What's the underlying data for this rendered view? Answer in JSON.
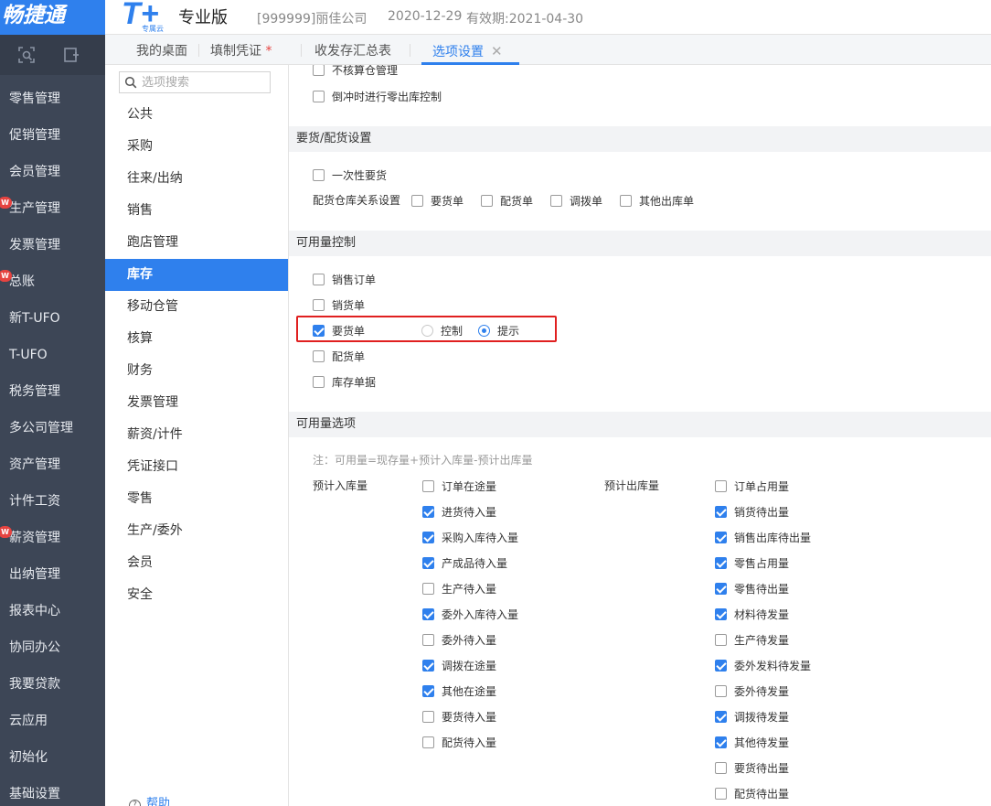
{
  "header": {
    "brand_name": "畅捷通",
    "logo_text": "T+",
    "logo_sub": "专属云",
    "edition": "专业版",
    "company": "[999999]丽佳公司",
    "date": "2020-12-29",
    "validity": "有效期:2021-04-30"
  },
  "nav": {
    "items": [
      {
        "label": "零售管理",
        "badge": ""
      },
      {
        "label": "促销管理",
        "badge": ""
      },
      {
        "label": "会员管理",
        "badge": ""
      },
      {
        "label": "生产管理",
        "badge": "W"
      },
      {
        "label": "发票管理",
        "badge": ""
      },
      {
        "label": "总账",
        "badge": "W"
      },
      {
        "label": "新T-UFO",
        "badge": ""
      },
      {
        "label": "T-UFO",
        "badge": ""
      },
      {
        "label": "税务管理",
        "badge": ""
      },
      {
        "label": "多公司管理",
        "badge": ""
      },
      {
        "label": "资产管理",
        "badge": ""
      },
      {
        "label": "计件工资",
        "badge": ""
      },
      {
        "label": "薪资管理",
        "badge": "W"
      },
      {
        "label": "出纳管理",
        "badge": ""
      },
      {
        "label": "报表中心",
        "badge": ""
      },
      {
        "label": "协同办公",
        "badge": ""
      },
      {
        "label": "我要贷款",
        "badge": ""
      },
      {
        "label": "云应用",
        "badge": ""
      },
      {
        "label": "初始化",
        "badge": ""
      },
      {
        "label": "基础设置",
        "badge": ""
      }
    ]
  },
  "tabs": [
    {
      "label": "我的桌面"
    },
    {
      "label": "填制凭证",
      "marker": "*"
    },
    {
      "label": "收发存汇总表"
    },
    {
      "label": "选项设置",
      "close": "✕"
    }
  ],
  "options": {
    "search_placeholder": "选项搜索",
    "categories": [
      "公共",
      "采购",
      "往来/出纳",
      "销售",
      "跑店管理",
      "库存",
      "移动仓管",
      "核算",
      "财务",
      "发票管理",
      "薪资/计件",
      "凭证接口",
      "零售",
      "生产/委外",
      "会员",
      "安全"
    ],
    "active_category": "库存",
    "help_label": "帮助"
  },
  "main": {
    "top_items": [
      {
        "label": "不核算仓管理",
        "checked": false
      },
      {
        "label": "倒冲时进行零出库控制",
        "checked": false
      }
    ],
    "section_yaohuo": {
      "title": "要货/配货设置",
      "one_time_label": "一次性要货",
      "one_time_checked": false,
      "relation_label": "配货仓库关系设置",
      "relation_items": [
        {
          "label": "要货单",
          "checked": false
        },
        {
          "label": "配货单",
          "checked": false
        },
        {
          "label": "调拨单",
          "checked": false
        },
        {
          "label": "其他出库单",
          "checked": false
        }
      ]
    },
    "section_control": {
      "title": "可用量控制",
      "items": [
        {
          "label": "销售订单",
          "checked": false
        },
        {
          "label": "销货单",
          "checked": false
        },
        {
          "label": "要货单",
          "checked": true
        },
        {
          "label": "配货单",
          "checked": false
        },
        {
          "label": "库存单据",
          "checked": false
        }
      ],
      "radio_control": "控制",
      "radio_hint": "提示",
      "selected_radio": "提示"
    },
    "section_avail": {
      "title": "可用量选项",
      "note": "注：可用量=现存量+预计入库量-预计出库量",
      "in_label": "预计入库量",
      "out_label": "预计出库量",
      "in_items": [
        {
          "label": "订单在途量",
          "checked": false
        },
        {
          "label": "进货待入量",
          "checked": true
        },
        {
          "label": "采购入库待入量",
          "checked": true
        },
        {
          "label": "产成品待入量",
          "checked": true
        },
        {
          "label": "生产待入量",
          "checked": false
        },
        {
          "label": "委外入库待入量",
          "checked": true
        },
        {
          "label": "委外待入量",
          "checked": false
        },
        {
          "label": "调拨在途量",
          "checked": true
        },
        {
          "label": "其他在途量",
          "checked": true
        },
        {
          "label": "要货待入量",
          "checked": false
        },
        {
          "label": "配货待入量",
          "checked": false
        }
      ],
      "out_items": [
        {
          "label": "订单占用量",
          "checked": false
        },
        {
          "label": "销货待出量",
          "checked": true
        },
        {
          "label": "销售出库待出量",
          "checked": true
        },
        {
          "label": "零售占用量",
          "checked": true
        },
        {
          "label": "零售待出量",
          "checked": true
        },
        {
          "label": "材料待发量",
          "checked": true
        },
        {
          "label": "生产待发量",
          "checked": false
        },
        {
          "label": "委外发料待发量",
          "checked": true
        },
        {
          "label": "委外待发量",
          "checked": false
        },
        {
          "label": "调拨待发量",
          "checked": true
        },
        {
          "label": "其他待发量",
          "checked": true
        },
        {
          "label": "要货待出量",
          "checked": false
        },
        {
          "label": "配货待出量",
          "checked": false
        }
      ]
    }
  },
  "colors": {
    "accent": "#2f80ed",
    "nav_bg": "#3d4656",
    "highlight": "#e02020",
    "badge": "#e64340"
  }
}
